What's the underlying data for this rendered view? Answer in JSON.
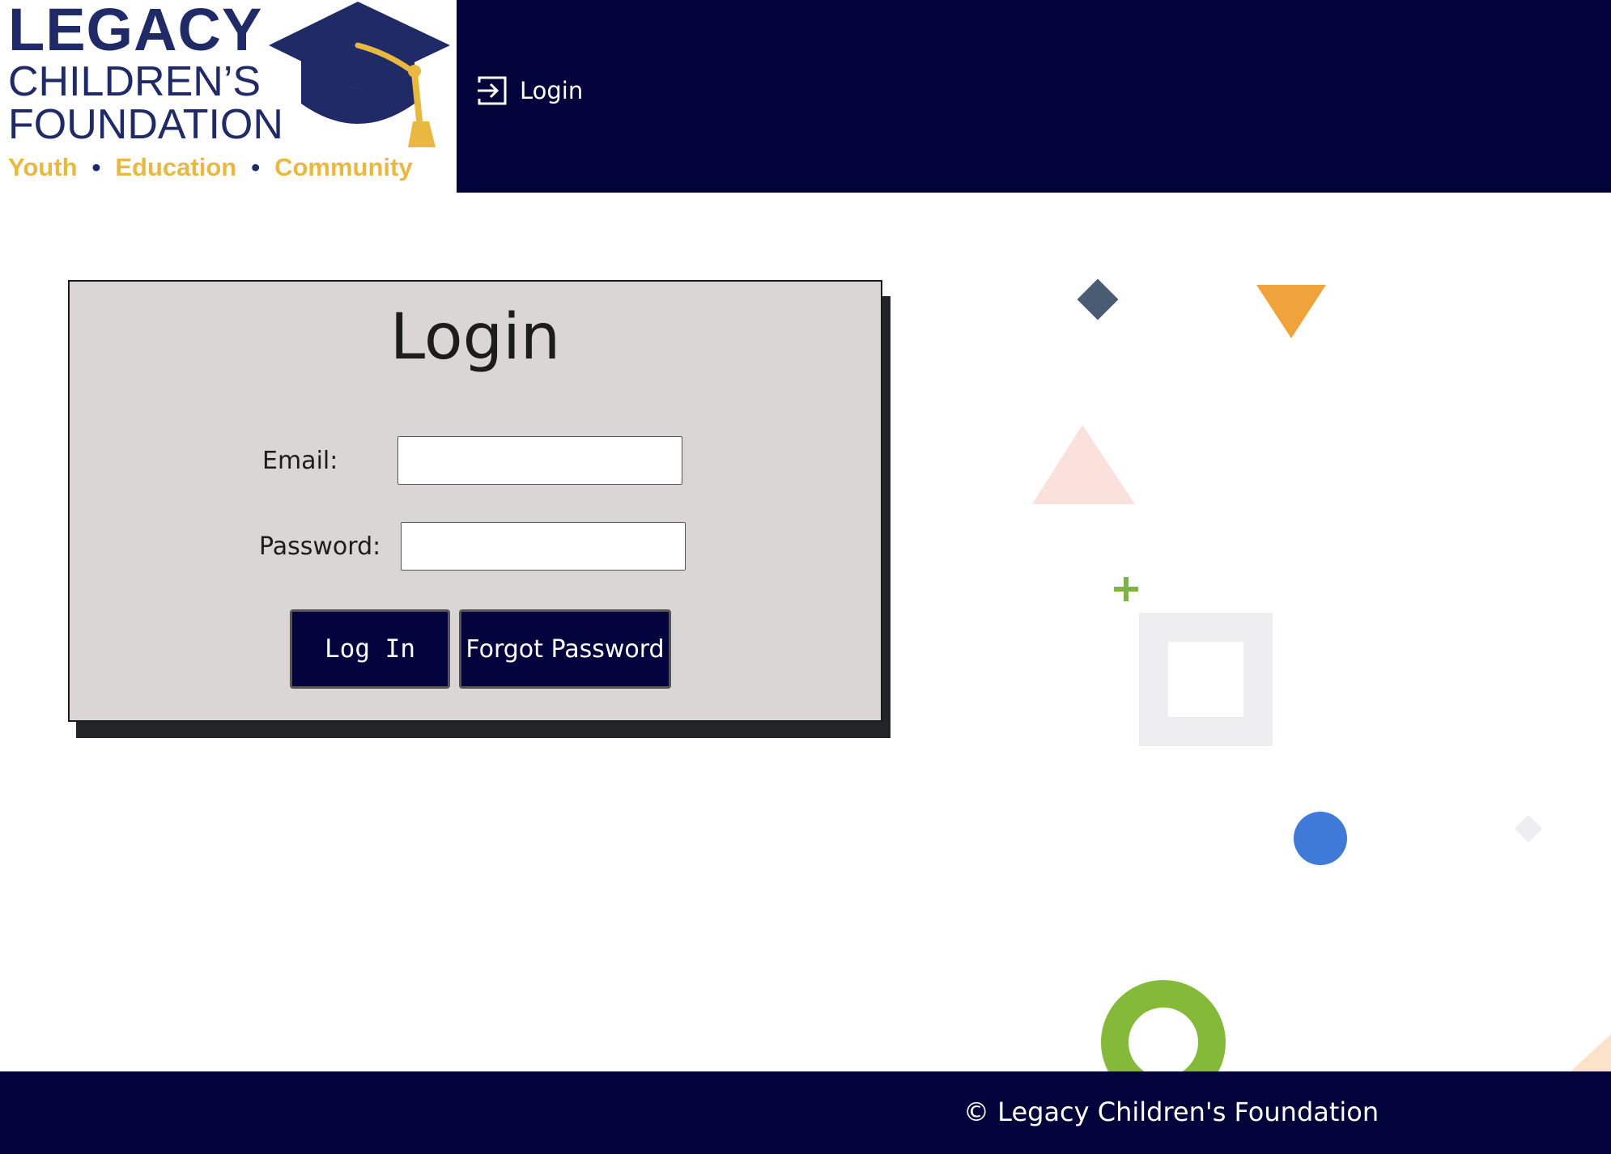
{
  "brand": {
    "line1": "LEGACY",
    "line2": "CHILDREN’S",
    "line3": "FOUNDATION",
    "tagline": [
      "Youth",
      "Education",
      "Community"
    ],
    "colors": {
      "navy": "#1f2a66",
      "gold": "#e8b840"
    }
  },
  "nav": {
    "login_label": "Login",
    "login_icon": "sign-in-icon"
  },
  "login_card": {
    "title": "Login",
    "email_label": "Email:",
    "email_value": "",
    "password_label": "Password:",
    "password_value": "",
    "login_button": "Log In",
    "forgot_button": "Forgot Password"
  },
  "footer": {
    "copyright": "© Legacy Children's Foundation"
  },
  "colors": {
    "header_bg": "#02033a",
    "card_bg": "#d9d6d5",
    "button_bg": "#03033d",
    "shape_diamond": "#4a5b74",
    "shape_triangle_orange": "#f0a23b",
    "shape_triangle_pink": "#fbe1dc",
    "shape_plus": "#7cb342",
    "shape_square_outline": "#eeeef0",
    "shape_circle_blue": "#3f7ad8",
    "shape_ring_green": "#85b93a"
  }
}
